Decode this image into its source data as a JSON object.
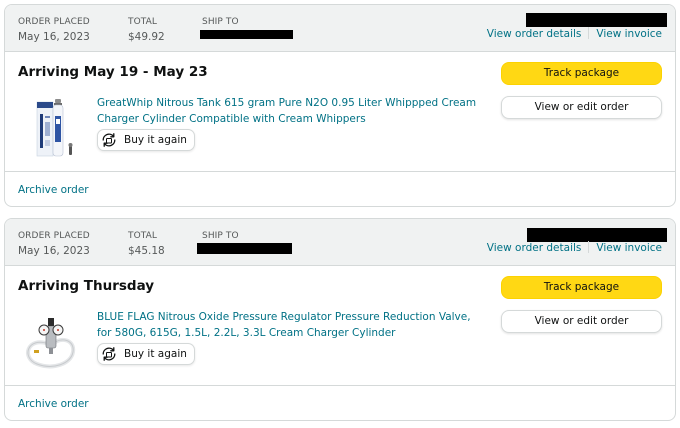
{
  "orders": [
    {
      "header": {
        "order_placed_label": "ORDER PLACED",
        "order_placed_value": "May 16, 2023",
        "total_label": "TOTAL",
        "total_value": "$49.92",
        "ship_to_label": "SHIP TO",
        "view_order_details": "View order details",
        "view_invoice": "View invoice"
      },
      "arriving": "Arriving May 19 - May 23",
      "product": {
        "title": "GreatWhip Nitrous Tank 615 gram Pure N2O 0.95 Liter Whippped Cream Charger Cylinder Compatible with Cream Whippers",
        "image_icon": "nitrous-tank-product-image"
      },
      "buy_again": "Buy it again",
      "track_package": "Track package",
      "view_edit_order": "View or edit order",
      "archive_order": "Archive order"
    },
    {
      "header": {
        "order_placed_label": "ORDER PLACED",
        "order_placed_value": "May 16, 2023",
        "total_label": "TOTAL",
        "total_value": "$45.18",
        "ship_to_label": "SHIP TO",
        "view_order_details": "View order details",
        "view_invoice": "View invoice"
      },
      "arriving": "Arriving Thursday",
      "product": {
        "title": "BLUE FLAG Nitrous Oxide Pressure Regulator Pressure Reduction Valve, for 580G, 615G, 1.5L, 2.2L, 3.3L Cream Charger Cylinder",
        "image_icon": "pressure-regulator-product-image"
      },
      "buy_again": "Buy it again",
      "track_package": "Track package",
      "view_edit_order": "View or edit order",
      "archive_order": "Archive order"
    }
  ],
  "colors": {
    "link": "#007185",
    "track_button": "#ffd814",
    "header_bg": "#f0f2f2",
    "border": "#d5d9d9"
  }
}
